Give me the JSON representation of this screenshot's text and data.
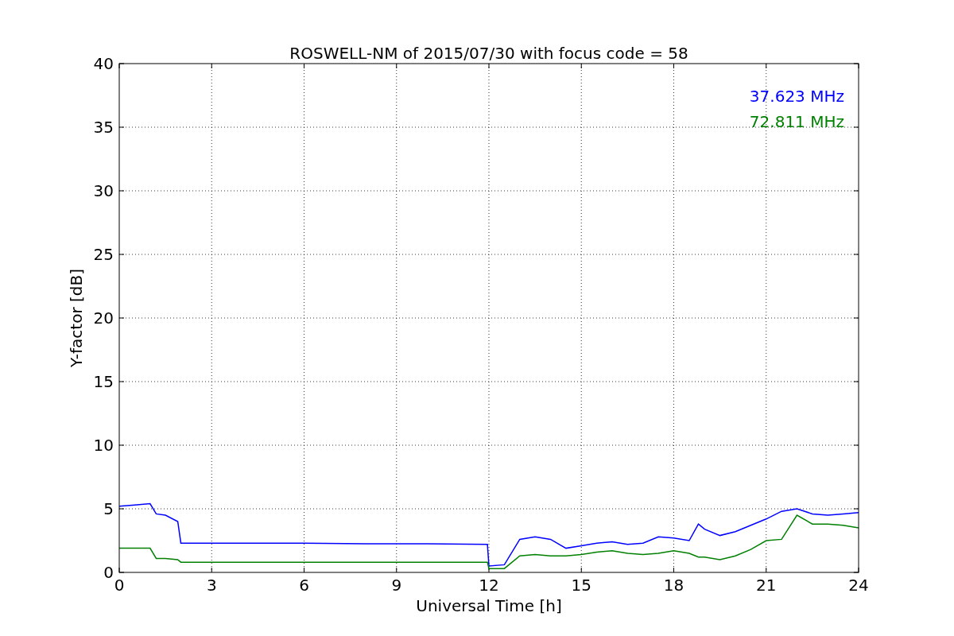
{
  "chart_data": {
    "type": "line",
    "title": "ROSWELL-NM of 2015/07/30 with focus code = 58",
    "xlabel": "Universal Time [h]",
    "ylabel": "Y-factor [dB]",
    "x": [
      0,
      0.5,
      1,
      1.2,
      1.5,
      1.9,
      2,
      4,
      6,
      8,
      10,
      11.95,
      12,
      12.5,
      13,
      13.5,
      14,
      14.5,
      15,
      15.5,
      16,
      16.5,
      17,
      17.5,
      18,
      18.5,
      18.8,
      19,
      19.5,
      20,
      20.5,
      21,
      21.5,
      22,
      22.5,
      23,
      23.5,
      24
    ],
    "series": [
      {
        "name": "37.623 MHz",
        "color": "#0000ff",
        "values": [
          5.2,
          5.3,
          5.4,
          4.6,
          4.5,
          4.0,
          2.3,
          2.3,
          2.3,
          2.25,
          2.25,
          2.2,
          0.5,
          0.6,
          2.6,
          2.8,
          2.6,
          1.9,
          2.1,
          2.3,
          2.4,
          2.2,
          2.3,
          2.8,
          2.7,
          2.5,
          3.8,
          3.4,
          2.9,
          3.2,
          3.7,
          4.2,
          4.8,
          5.0,
          4.6,
          4.5,
          4.6,
          4.7
        ]
      },
      {
        "name": "72.811 MHz",
        "color": "#008000",
        "values": [
          1.9,
          1.9,
          1.9,
          1.1,
          1.1,
          1.0,
          0.8,
          0.8,
          0.8,
          0.8,
          0.8,
          0.8,
          0.3,
          0.3,
          1.3,
          1.4,
          1.3,
          1.3,
          1.4,
          1.6,
          1.7,
          1.5,
          1.4,
          1.5,
          1.7,
          1.5,
          1.2,
          1.2,
          1.0,
          1.3,
          1.8,
          2.5,
          2.6,
          4.5,
          3.8,
          3.8,
          3.7,
          3.5
        ]
      }
    ],
    "xlim": [
      0,
      24
    ],
    "ylim": [
      0,
      40
    ],
    "xticks": [
      0,
      3,
      6,
      9,
      12,
      15,
      18,
      21,
      24
    ],
    "yticks": [
      0,
      5,
      10,
      15,
      20,
      25,
      30,
      35,
      40
    ],
    "grid": true
  }
}
